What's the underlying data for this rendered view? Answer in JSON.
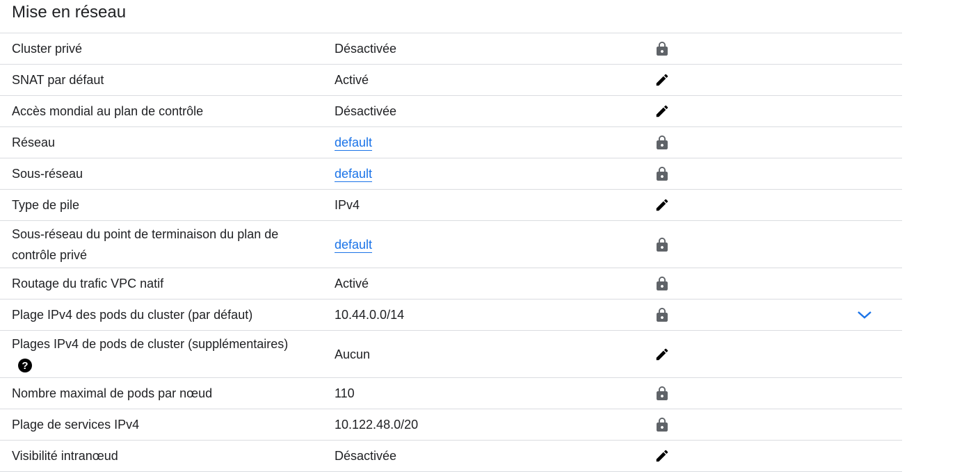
{
  "section": {
    "title": "Mise en réseau"
  },
  "rows": [
    {
      "label": "Cluster privé",
      "value": "Désactivée",
      "value_is_link": false,
      "action_icon": "lock-icon"
    },
    {
      "label": "SNAT par défaut",
      "value": "Activé",
      "value_is_link": false,
      "action_icon": "edit-icon"
    },
    {
      "label": "Accès mondial au plan de contrôle",
      "value": "Désactivée",
      "value_is_link": false,
      "action_icon": "edit-icon"
    },
    {
      "label": "Réseau",
      "value": "default",
      "value_is_link": true,
      "action_icon": "lock-icon"
    },
    {
      "label": "Sous-réseau",
      "value": "default",
      "value_is_link": true,
      "action_icon": "lock-icon"
    },
    {
      "label": "Type de pile",
      "value": "IPv4",
      "value_is_link": false,
      "action_icon": "edit-icon"
    },
    {
      "label": "Sous-réseau du point de terminaison du plan de contrôle privé",
      "label_line1": "Sous-réseau du point de terminaison du plan de",
      "label_line2": "contrôle privé",
      "value": "default",
      "value_is_link": true,
      "action_icon": "lock-icon"
    },
    {
      "label": "Routage du trafic VPC natif",
      "value": "Activé",
      "value_is_link": false,
      "action_icon": "lock-icon"
    },
    {
      "label": "Plage IPv4 des pods du cluster (par défaut)",
      "value": "10.44.0.0/14",
      "value_is_link": false,
      "action_icon": "lock-icon",
      "expand_icon": "chevron-down-icon"
    },
    {
      "label": "Plages IPv4 de pods de cluster (supplémentaires)",
      "value": "Aucun",
      "value_is_link": false,
      "action_icon": "edit-icon",
      "help_icon": "help-icon"
    },
    {
      "label": "Nombre maximal de pods par nœud",
      "value": "110",
      "value_is_link": false,
      "action_icon": "lock-icon"
    },
    {
      "label": "Plage de services IPv4",
      "value": "10.122.48.0/20",
      "value_is_link": false,
      "action_icon": "lock-icon"
    },
    {
      "label": "Visibilité intranœud",
      "value": "Désactivée",
      "value_is_link": false,
      "action_icon": "edit-icon"
    }
  ],
  "colors": {
    "text": "#202124",
    "link": "#1a73e8",
    "lock": "#5f6368",
    "edit": "#000000",
    "divider": "#dadce0",
    "chevron": "#1a73e8"
  }
}
